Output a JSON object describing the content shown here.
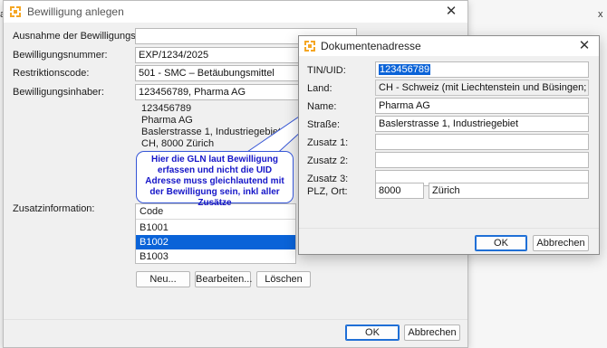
{
  "background": {
    "right_text": "x",
    "left_text": "a"
  },
  "main_dialog": {
    "title": "Bewilligung anlegen",
    "labels": {
      "ausnahme": "Ausnahme der Bewilligungspflicht:",
      "nummer": "Bewilligungsnummer:",
      "restriktion": "Restriktionscode:",
      "inhaber": "Bewilligungsinhaber:",
      "zusatz": "Zusatzinformation:"
    },
    "values": {
      "ausnahme": "",
      "nummer": "EXP/1234/2025",
      "restriktion": "501 - SMC – Betäubungsmittel",
      "inhaber": "123456789, Pharma AG"
    },
    "address_lines": [
      "123456789",
      "Pharma AG",
      "Baslerstrasse 1, Industriegebiet",
      "CH, 8000 Zürich"
    ],
    "zusatz_list": {
      "header": "Code",
      "rows": [
        "B1001",
        "B1002",
        "B1003"
      ],
      "selected_index": 1
    },
    "buttons": {
      "neu": "Neu...",
      "bearbeiten": "Bearbeiten...",
      "loeschen": "Löschen",
      "ok": "OK",
      "abbrechen": "Abbrechen"
    }
  },
  "address_dialog": {
    "title": "Dokumentenadresse",
    "labels": {
      "tin": "TIN/UID:",
      "land": "Land:",
      "name": "Name:",
      "strasse": "Straße:",
      "zusatz1": "Zusatz 1:",
      "zusatz2": "Zusatz 2:",
      "zusatz3": "Zusatz 3:",
      "plz_ort": "PLZ, Ort:"
    },
    "values": {
      "tin": "123456789",
      "land": "CH - Schweiz (mit Liechtenstein und Büsingen; ohne Campione)",
      "name": "Pharma AG",
      "strasse": "Baslerstrasse 1, Industriegebiet",
      "zusatz1": "",
      "zusatz2": "",
      "zusatz3": "",
      "plz": "8000",
      "ort": "Zürich"
    },
    "buttons": {
      "ok": "OK",
      "abbrechen": "Abbrechen"
    }
  },
  "callout": {
    "text": "Hier die GLN laut Bewilligung erfassen und nicht die UID Adresse muss gleichlautend mit der Bewilligung sein, inkl aller Zusätze"
  },
  "colors": {
    "selection": "#0a63d8",
    "callout_text": "#1515c8",
    "callout_border": "#3555d6",
    "icon_orange": "#f5a623"
  },
  "icons": {
    "app_icon": "app-logo-icon",
    "close": "close-icon"
  }
}
